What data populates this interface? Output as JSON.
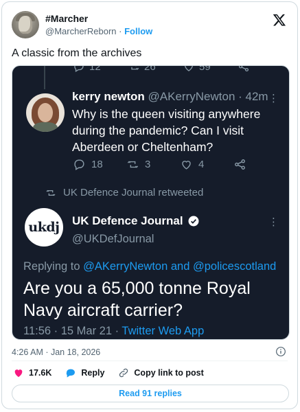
{
  "header": {
    "display_name": "#Marcher",
    "handle": "@MarcherReborn",
    "separator": "·",
    "follow_label": "Follow"
  },
  "tweet": {
    "text": "A classic from the archives"
  },
  "screenshot": {
    "cut_stats": [
      "12",
      "26",
      "59"
    ],
    "kerry": {
      "name": "kerry newton",
      "handle_time": "@AKerryNewton · 42m",
      "text": "Why is the queen visiting anywhere during the pandemic?  Can I visit Aberdeen or Cheltenham?",
      "replies": "18",
      "retweets": "3",
      "likes": "4"
    },
    "retweet_note": "UK Defence Journal retweeted",
    "ukdj": {
      "avatar_text": "ukdj",
      "name": "UK Defence Journal",
      "handle": "@UKDefJournal",
      "replying_prefix": "Replying to",
      "mention1": "@AKerryNewton",
      "and_word": "and",
      "mention2": "@policescotland",
      "text": "Are you a 65,000 tonne Royal Navy aircraft carrier?",
      "time_date": "11:56 · 15 Mar 21 ·",
      "app": "Twitter Web App"
    }
  },
  "footer": {
    "timestamp": "4:26 AM · Jan 18, 2026",
    "likes": "17.6K",
    "reply_label": "Reply",
    "copy_label": "Copy link to post",
    "read_replies": "Read 91 replies"
  },
  "colors": {
    "accent": "#1d9bf0",
    "like": "#f91880",
    "dark_bg": "#151c2a"
  }
}
